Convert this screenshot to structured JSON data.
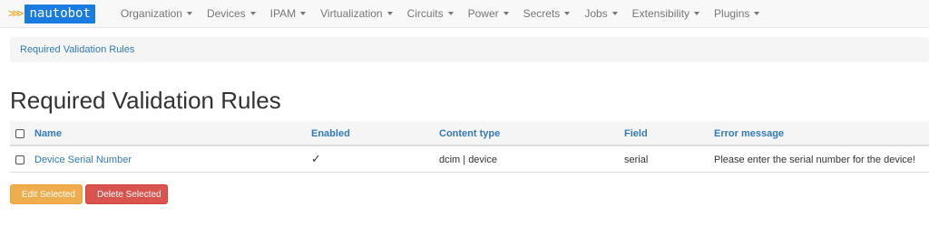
{
  "brand": {
    "arrows": ">>>",
    "name": "nautobot"
  },
  "nav": {
    "items": [
      {
        "label": "Organization"
      },
      {
        "label": "Devices"
      },
      {
        "label": "IPAM"
      },
      {
        "label": "Virtualization"
      },
      {
        "label": "Circuits"
      },
      {
        "label": "Power"
      },
      {
        "label": "Secrets"
      },
      {
        "label": "Jobs"
      },
      {
        "label": "Extensibility"
      },
      {
        "label": "Plugins"
      }
    ]
  },
  "breadcrumb": {
    "label": "Required Validation Rules"
  },
  "page": {
    "title": "Required Validation Rules"
  },
  "table": {
    "headers": {
      "name": "Name",
      "enabled": "Enabled",
      "content_type": "Content type",
      "field": "Field",
      "error_message": "Error message"
    },
    "rows": [
      {
        "name": "Device Serial Number",
        "enabled": "✓",
        "content_type": "dcim | device",
        "field": "serial",
        "error_message": "Please enter the serial number for the device!"
      }
    ]
  },
  "actions": {
    "edit_label": "Edit Selected",
    "delete_label": "Delete Selected"
  },
  "colors": {
    "link": "#337ab7",
    "warning": "#f0ad4e",
    "danger": "#d9534f",
    "brand": "#1a7be0",
    "brand_arrows": "#f5a623"
  }
}
